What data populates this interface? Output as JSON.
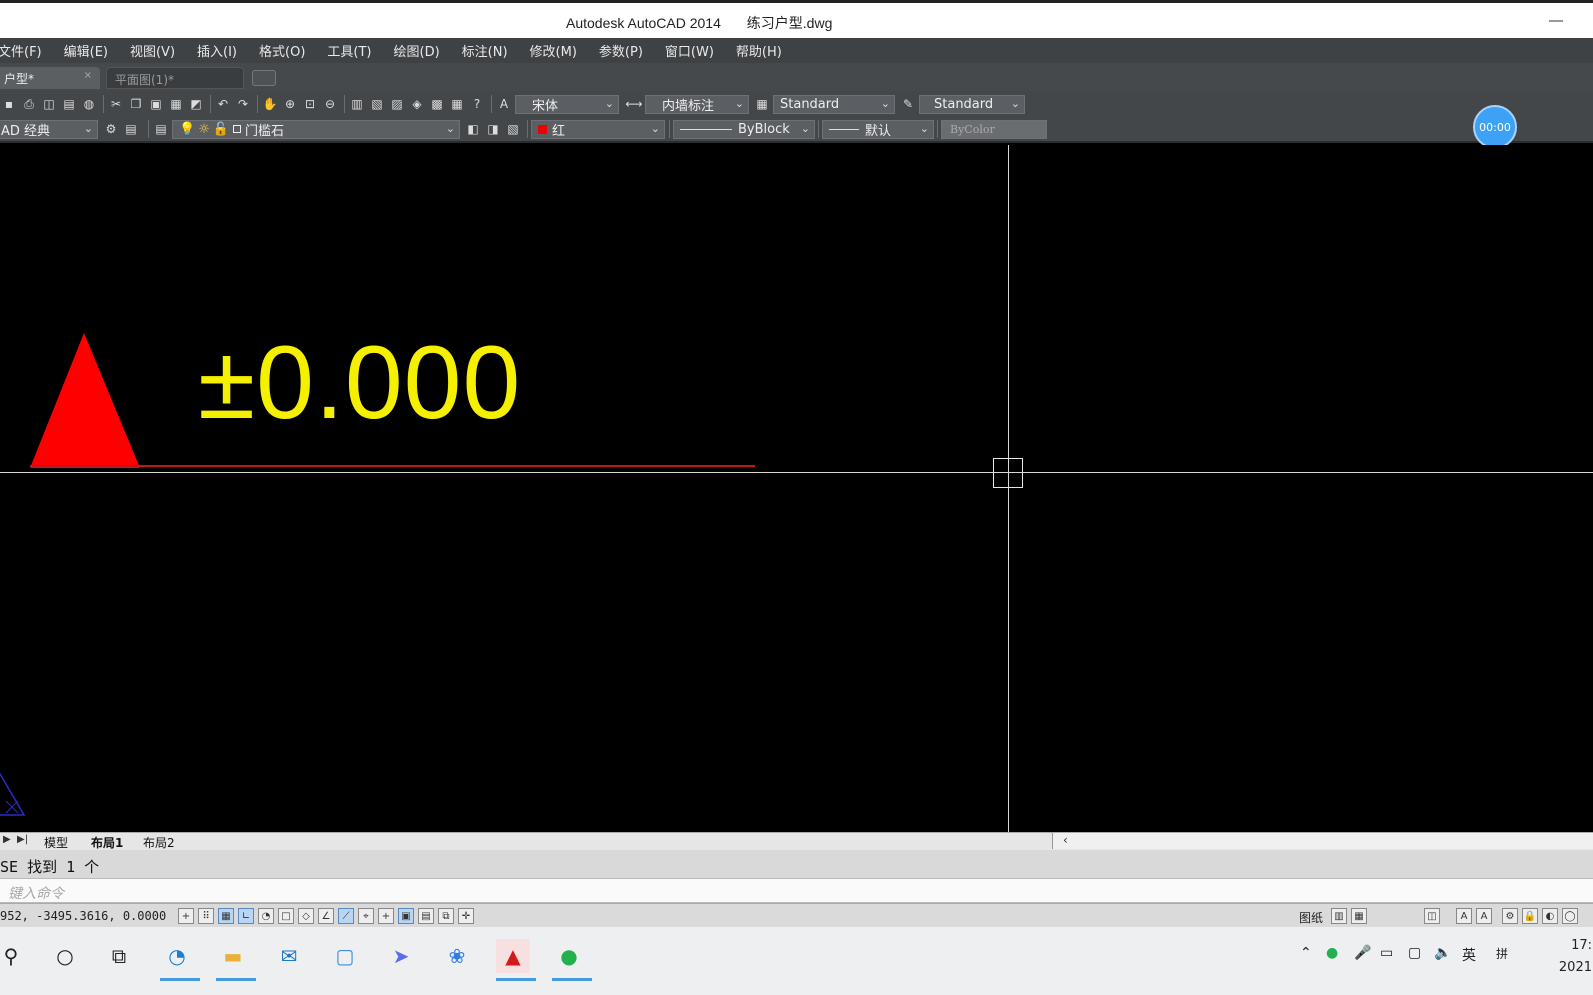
{
  "window": {
    "app_title": "Autodesk AutoCAD 2014",
    "file_title": "练习户型.dwg"
  },
  "menu": [
    "文件(F)",
    "编辑(E)",
    "视图(V)",
    "插入(I)",
    "格式(O)",
    "工具(T)",
    "绘图(D)",
    "标注(N)",
    "修改(M)",
    "参数(P)",
    "窗口(W)",
    "帮助(H)"
  ],
  "file_tabs": {
    "active": "户型*",
    "inactive": "平面图(1)*",
    "close_glyph": "×"
  },
  "toolbar_row1": {
    "text_style_font": "宋体",
    "dim_style": "内墙标注",
    "table_style": "Standard",
    "multileader_style": "Standard"
  },
  "toolbar_row2": {
    "workspace": "AD 经典",
    "layer": "门槛石",
    "color": "红",
    "linetype": "ByBlock",
    "lineweight": "默认",
    "plotstyle": "ByColor"
  },
  "recorder": {
    "time": "00:00"
  },
  "drawing": {
    "elevation_text": "±0.000",
    "elevation_text_color": "#f4f000",
    "symbol_color": "#ff0000"
  },
  "layout_tabs": [
    "模型",
    "布局1",
    "布局2"
  ],
  "command": {
    "history": "SE 找到 1 个",
    "placeholder": "键入命令"
  },
  "status": {
    "coordinates": "952,  -3495.3616, 0.0000",
    "paper_label": "图纸"
  },
  "taskbar": {
    "apps": [
      "search-icon",
      "cortana-icon",
      "task-view-icon",
      "edge-icon",
      "file-explorer-icon",
      "mail-icon",
      "dingtalk-icon",
      "feishu-icon",
      "baidu-netdisk-icon",
      "autocad-icon",
      "wechat-icon"
    ],
    "ime_lang": "英",
    "ime_mode": "拼",
    "time": "17:",
    "date": "2021"
  }
}
